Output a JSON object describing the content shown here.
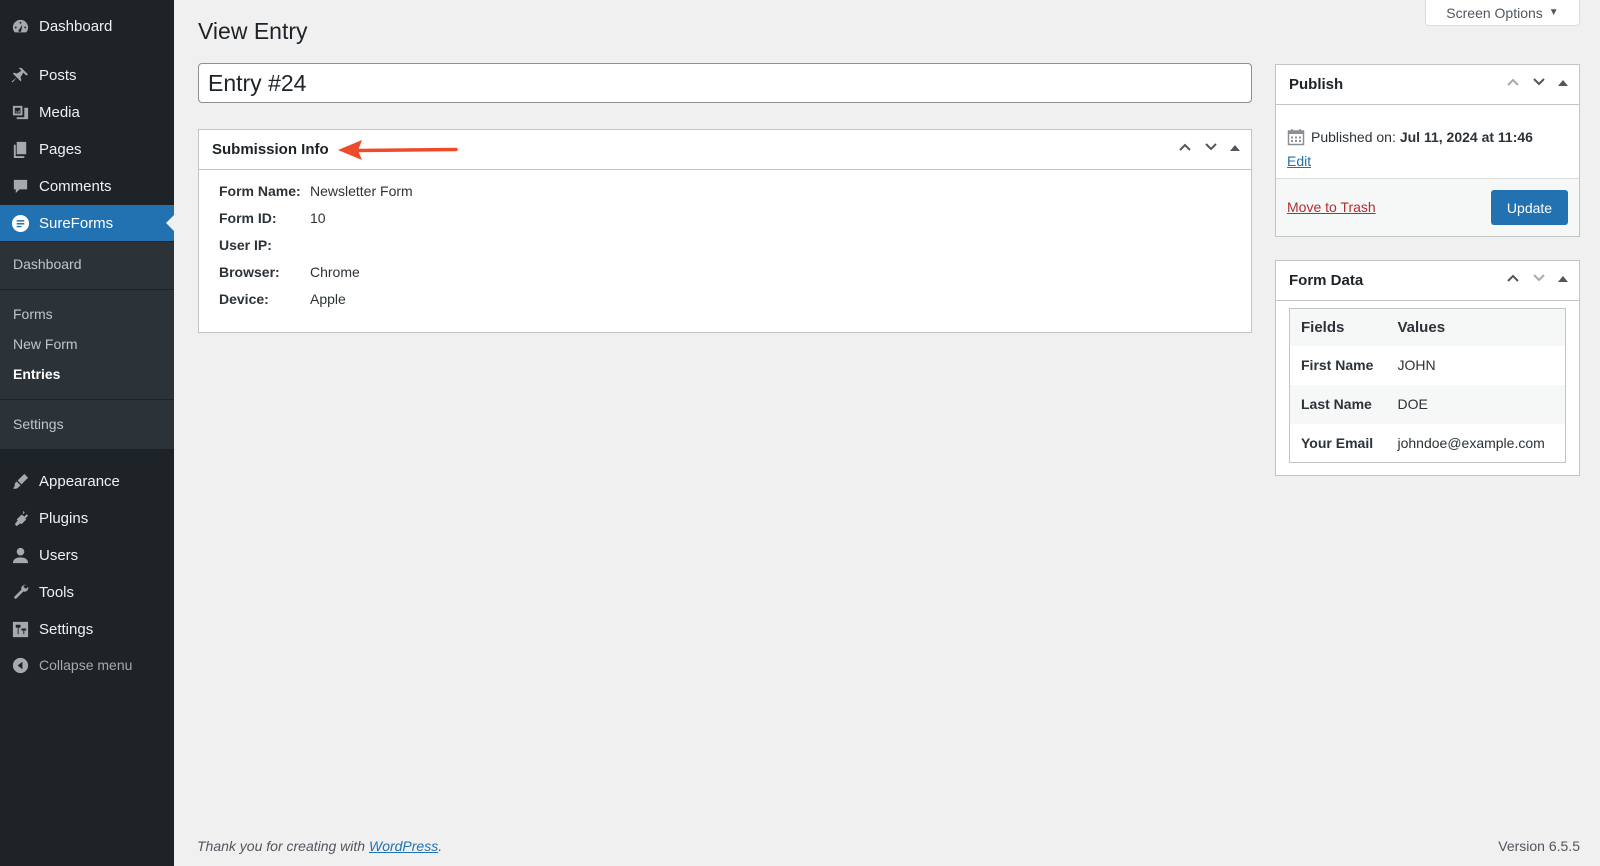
{
  "sidebar": {
    "menu": [
      {
        "label": "Dashboard",
        "icon": "dashboard-icon"
      },
      {
        "label": "Posts",
        "icon": "pin-icon"
      },
      {
        "label": "Media",
        "icon": "media-icon"
      },
      {
        "label": "Pages",
        "icon": "pages-icon"
      },
      {
        "label": "Comments",
        "icon": "comment-icon"
      },
      {
        "label": "SureForms",
        "icon": "sureforms-icon"
      },
      {
        "label": "Appearance",
        "icon": "brush-icon"
      },
      {
        "label": "Plugins",
        "icon": "plugin-icon"
      },
      {
        "label": "Users",
        "icon": "user-icon"
      },
      {
        "label": "Tools",
        "icon": "wrench-icon"
      },
      {
        "label": "Settings",
        "icon": "settings-icon"
      }
    ],
    "submenu": {
      "dashboard": "Dashboard",
      "forms": "Forms",
      "new_form": "New Form",
      "entries": "Entries",
      "settings": "Settings"
    },
    "collapse_label": "Collapse menu"
  },
  "header": {
    "screen_options": "Screen Options",
    "page_title": "View Entry",
    "entry_title": "Entry #24"
  },
  "submission": {
    "title": "Submission Info",
    "rows": [
      {
        "label": "Form Name:",
        "value": "Newsletter Form"
      },
      {
        "label": "Form ID:",
        "value": "10"
      },
      {
        "label": "User IP:",
        "value": ""
      },
      {
        "label": "Browser:",
        "value": "Chrome"
      },
      {
        "label": "Device:",
        "value": "Apple"
      }
    ]
  },
  "publish": {
    "title": "Publish",
    "published_label": "Published on:",
    "published_date": "Jul 11, 2024 at 11:46",
    "edit_label": "Edit",
    "trash_label": "Move to Trash",
    "update_label": "Update"
  },
  "form_data": {
    "title": "Form Data",
    "headers": {
      "fields": "Fields",
      "values": "Values"
    },
    "rows": [
      {
        "field": "First Name",
        "value": "JOHN"
      },
      {
        "field": "Last Name",
        "value": "DOE"
      },
      {
        "field": "Your Email",
        "value": "johndoe@example.com"
      }
    ]
  },
  "footer": {
    "thanks_prefix": "Thank you for creating with ",
    "thanks_link": "WordPress",
    "thanks_suffix": ".",
    "version": "Version 6.5.5"
  },
  "colors": {
    "sidebar_bg": "#1d2327",
    "accent": "#2271b1",
    "arrow": "#ee4b2b",
    "trash": "#b32d2e"
  }
}
